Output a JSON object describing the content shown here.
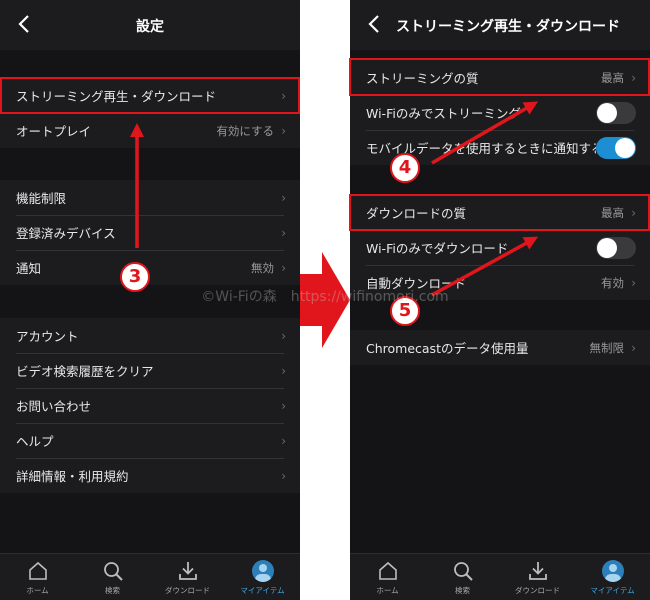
{
  "left": {
    "title": "設定",
    "rows": [
      {
        "label": "ストリーミング再生・ダウンロード",
        "value": ""
      },
      {
        "label": "オートプレイ",
        "value": "有効にする"
      },
      {
        "label": "機能制限",
        "value": ""
      },
      {
        "label": "登録済みデバイス",
        "value": ""
      },
      {
        "label": "通知",
        "value": "無効"
      },
      {
        "label": "アカウント",
        "value": ""
      },
      {
        "label": "ビデオ検索履歴をクリア",
        "value": ""
      },
      {
        "label": "お問い合わせ",
        "value": ""
      },
      {
        "label": "ヘルプ",
        "value": ""
      },
      {
        "label": "詳細情報・利用規約",
        "value": ""
      }
    ]
  },
  "right": {
    "title": "ストリーミング再生・ダウンロード",
    "rows": [
      {
        "label": "ストリーミングの質",
        "value": "最高"
      },
      {
        "label": "Wi-Fiのみでストリーミング",
        "toggle": "off"
      },
      {
        "label": "モバイルデータを使用するときに通知する",
        "toggle": "on"
      },
      {
        "label": "ダウンロードの質",
        "value": "最高"
      },
      {
        "label": "Wi-Fiのみでダウンロード",
        "toggle": "off"
      },
      {
        "label": "自動ダウンロード",
        "value": "有効"
      },
      {
        "label": "Chromecastのデータ使用量",
        "value": "無制限"
      }
    ]
  },
  "tabs": [
    {
      "label": "ホーム",
      "icon": "home-icon"
    },
    {
      "label": "検索",
      "icon": "search-icon"
    },
    {
      "label": "ダウンロード",
      "icon": "download-icon"
    },
    {
      "label": "マイアイテム",
      "icon": "avatar-icon"
    }
  ],
  "annotations": {
    "step3": "3",
    "step4": "4",
    "step5": "5"
  },
  "watermark": "©Wi-Fiの森　https://wifinomori.com",
  "colors": {
    "highlight": "#e1161c",
    "accent": "#1e8ed3",
    "background": "#1c1c1e"
  }
}
